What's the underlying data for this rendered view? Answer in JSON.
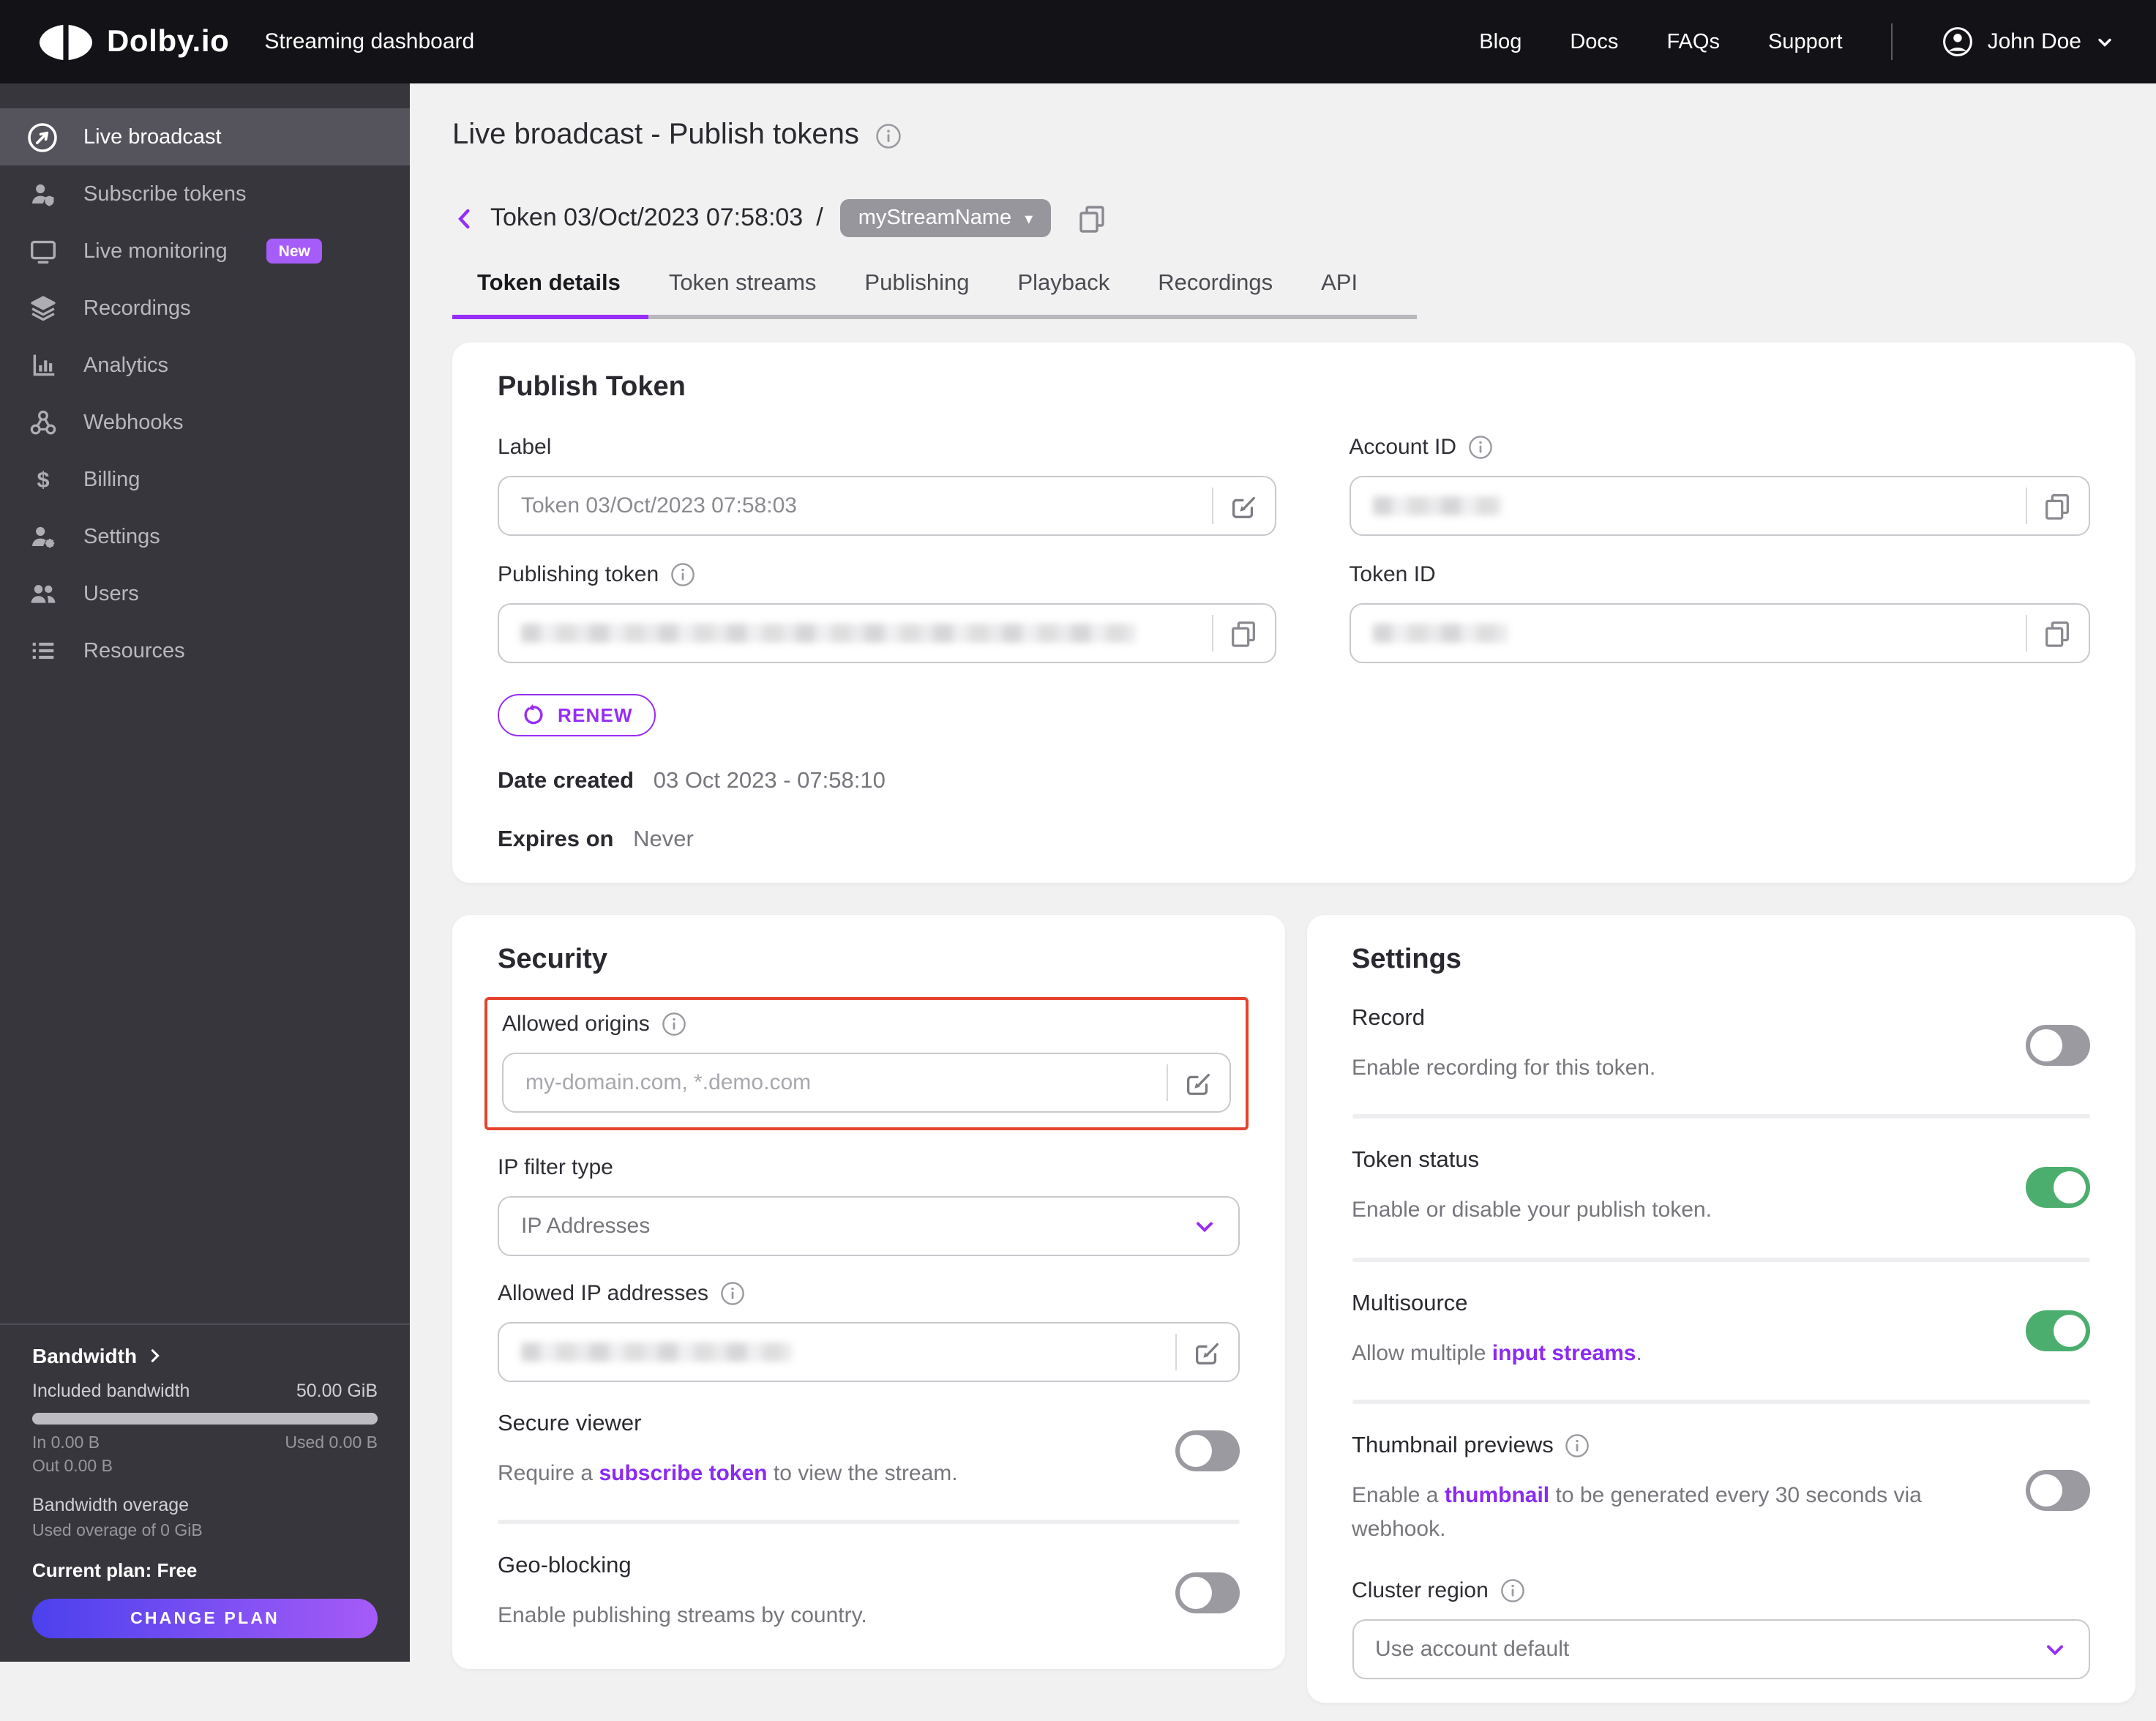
{
  "colors": {
    "accent-purple": "#962ef7",
    "badge-purple": "#a55cf8",
    "link-purple": "#8a2bf2",
    "highlight-red": "#e5432d",
    "toggle-on-green": "#4cae6e",
    "toggle-off-gray": "#9b9aa1",
    "gradient-start": "#4b41ee",
    "gradient-end": "#a65bf7"
  },
  "topbar": {
    "logo": "Dolby.io",
    "product": "Streaming dashboard",
    "nav": [
      "Blog",
      "Docs",
      "FAQs",
      "Support"
    ],
    "user": {
      "name": "John Doe"
    }
  },
  "sidebar": {
    "items": [
      {
        "label": "Live broadcast"
      },
      {
        "label": "Subscribe tokens"
      },
      {
        "label": "Live monitoring",
        "badge": "New"
      },
      {
        "label": "Recordings"
      },
      {
        "label": "Analytics"
      },
      {
        "label": "Webhooks"
      },
      {
        "label": "Billing"
      },
      {
        "label": "Settings"
      },
      {
        "label": "Users"
      },
      {
        "label": "Resources"
      }
    ],
    "bandwidth": {
      "title": "Bandwidth",
      "included_label": "Included bandwidth",
      "included_value": "50.00 GiB",
      "in_label": "In 0.00 B",
      "used_label": "Used 0.00 B",
      "out_label": "Out 0.00 B",
      "overage_title": "Bandwidth overage",
      "overage_detail": "Used overage of 0 GiB",
      "plan": "Current plan: Free",
      "change_plan": "CHANGE PLAN"
    }
  },
  "page": {
    "title": "Live broadcast - Publish tokens",
    "breadcrumb": {
      "token": "Token 03/Oct/2023 07:58:03",
      "separator": "/",
      "stream": "myStreamName"
    },
    "tabs": [
      "Token details",
      "Token streams",
      "Publishing",
      "Playback",
      "Recordings",
      "API"
    ],
    "active_tab": "Token details"
  },
  "publish_token": {
    "heading": "Publish Token",
    "label": {
      "title": "Label",
      "value": "Token 03/Oct/2023 07:58:03"
    },
    "account_id": {
      "title": "Account ID",
      "value_redacted": true
    },
    "publishing_token": {
      "title": "Publishing token",
      "value_redacted": true
    },
    "token_id": {
      "title": "Token ID",
      "value_redacted": true
    },
    "renew_button": "RENEW",
    "date_created": {
      "title": "Date created",
      "value": "03 Oct 2023 - 07:58:10"
    },
    "expires_on": {
      "title": "Expires on",
      "value": "Never"
    }
  },
  "security": {
    "heading": "Security",
    "allowed_origins": {
      "title": "Allowed origins",
      "placeholder": "my-domain.com, *.demo.com",
      "highlighted": true
    },
    "ip_filter_type": {
      "title": "IP filter type",
      "value": "IP Addresses"
    },
    "allowed_ips": {
      "title": "Allowed IP addresses",
      "value_redacted": true
    },
    "secure_viewer": {
      "title": "Secure viewer",
      "enabled": false,
      "description_pre": "Require a ",
      "description_link": "subscribe token",
      "description_post": " to view the stream."
    },
    "geo_blocking": {
      "title": "Geo-blocking",
      "enabled": false,
      "description": "Enable publishing streams by country."
    }
  },
  "settings_card": {
    "heading": "Settings",
    "record": {
      "title": "Record",
      "enabled": false,
      "description": "Enable recording for this token."
    },
    "token_status": {
      "title": "Token status",
      "enabled": true,
      "description": "Enable or disable your publish token."
    },
    "multisource": {
      "title": "Multisource",
      "enabled": true,
      "description_pre": "Allow multiple ",
      "description_link": "input streams",
      "description_post": "."
    },
    "thumbnail_previews": {
      "title": "Thumbnail previews",
      "enabled": false,
      "description_pre": "Enable a ",
      "description_link": "thumbnail",
      "description_post": " to be generated every 30 seconds via webhook."
    },
    "cluster_region": {
      "title": "Cluster region",
      "value": "Use account default"
    }
  }
}
